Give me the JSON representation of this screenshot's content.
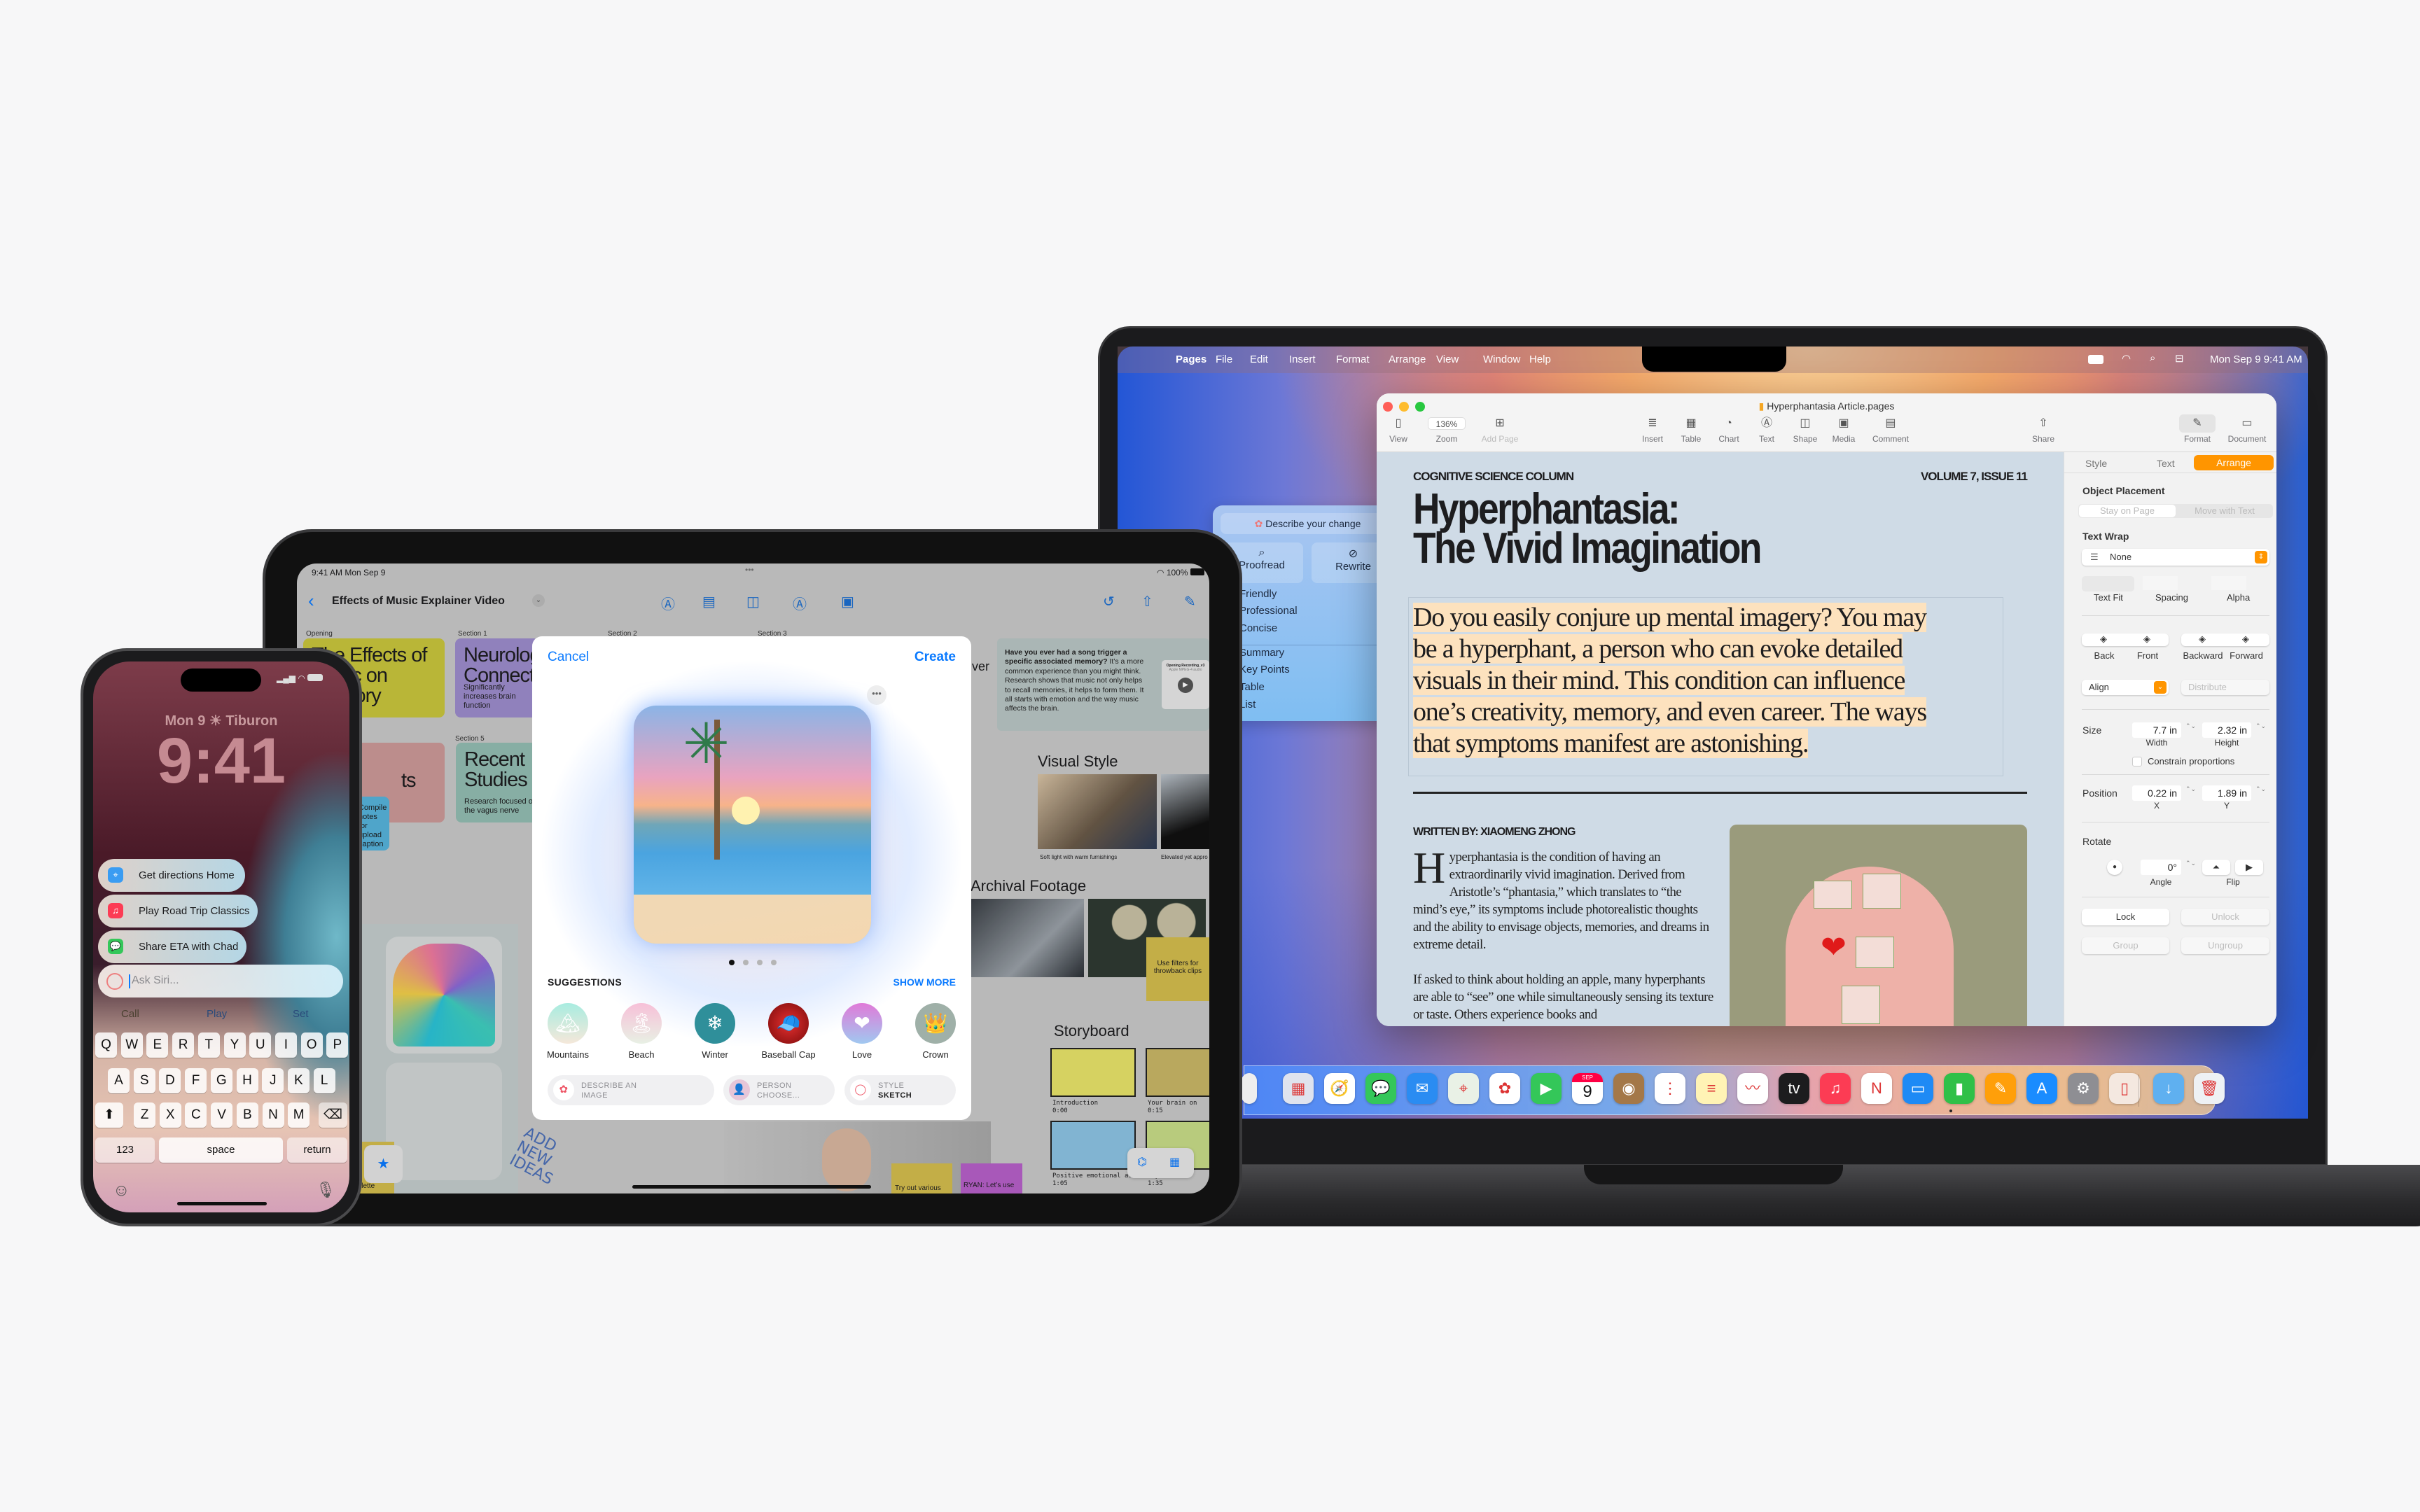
{
  "colors": {
    "accent_orange": "#ff9500",
    "ios_blue": "#0a7aff",
    "highlight": "#fde2be",
    "doc_bg": "#cfdbe6"
  },
  "mac": {
    "menubar": {
      "apple": "",
      "items": [
        "Pages",
        "File",
        "Edit",
        "Insert",
        "Format",
        "Arrange",
        "View",
        "Window",
        "Help"
      ],
      "status_icons": [
        "battery-icon",
        "wifi-icon",
        "search-icon",
        "control-center-icon"
      ],
      "datetime": "Mon Sep 9  9:41 AM"
    },
    "window": {
      "title": "Hyperphantasia Article.pages",
      "toolbar": [
        {
          "label": "View",
          "icon": "sidebar-icon"
        },
        {
          "label": "Zoom",
          "value": "136%"
        },
        {
          "label": "Add Page",
          "icon": "add-page-icon",
          "disabled": true
        },
        {
          "label": "Insert",
          "icon": "insert-icon"
        },
        {
          "label": "Table",
          "icon": "table-icon"
        },
        {
          "label": "Chart",
          "icon": "chart-icon"
        },
        {
          "label": "Text",
          "icon": "text-icon"
        },
        {
          "label": "Shape",
          "icon": "shape-icon"
        },
        {
          "label": "Media",
          "icon": "media-icon"
        },
        {
          "label": "Comment",
          "icon": "comment-icon"
        },
        {
          "label": "Share",
          "icon": "share-icon"
        },
        {
          "label": "Format",
          "icon": "format-brush-icon",
          "active": true
        },
        {
          "label": "Document",
          "icon": "document-icon"
        }
      ],
      "document": {
        "kicker": "COGNITIVE SCIENCE COLUMN",
        "issue": "VOLUME 7, ISSUE 11",
        "title_lines": [
          "Hyperphantasia:",
          "The Vivid Imagination"
        ],
        "intro_lines": [
          "Do you easily conjure up mental imagery? You may",
          "be a hyperphant, a person who can evoke detailed",
          "visuals in their mind. This condition can influence",
          "one’s creativity, memory, and even career. The ways",
          "that symptoms manifest are astonishing."
        ],
        "byline": "WRITTEN BY: XIAOMENG ZHONG",
        "drop_cap": "H",
        "body": [
          "yperphantasia is the condition of having an extraordinarily vivid imagination. Derived from Aristotle’s “phantasia,” which translates to “the mind’s eye,” its symptoms include photorealistic thoughts and the ability to envisage objects, memories, and dreams in extreme detail.",
          "If asked to think about holding an apple, many hyperphants are able to “see” one while simultaneously sensing its texture or taste. Others experience books and"
        ]
      },
      "inspector": {
        "tabs": [
          "Style",
          "Text",
          "Arrange"
        ],
        "active_tab": "Arrange",
        "object_placement": {
          "label": "Object Placement",
          "options": [
            "Stay on Page",
            "Move with Text"
          ]
        },
        "text_wrap": {
          "label": "Text Wrap",
          "value": "None"
        },
        "text_fit": "Text Fit",
        "spacing": "Spacing",
        "alpha": "Alpha",
        "arrange_buttons": [
          "Back",
          "Front",
          "Backward",
          "Forward"
        ],
        "align": "Align",
        "distribute": "Distribute",
        "size": {
          "label": "Size",
          "width": "7.7 in",
          "height": "2.32 in",
          "width_label": "Width",
          "height_label": "Height",
          "constrain": "Constrain proportions",
          "constrain_checked": false
        },
        "position": {
          "label": "Position",
          "x": "0.22 in",
          "y": "1.89 in",
          "x_label": "X",
          "y_label": "Y"
        },
        "rotate": {
          "label": "Rotate",
          "angle": "0°",
          "angle_label": "Angle",
          "flip_label": "Flip"
        },
        "lock": "Lock",
        "unlock": "Unlock",
        "group": "Group",
        "ungroup": "Ungroup"
      }
    },
    "writing_tools": {
      "prompt": "Describe your change",
      "actions": [
        "Proofread",
        "Rewrite"
      ],
      "tones": [
        "Friendly",
        "Professional",
        "Concise"
      ],
      "formats": [
        "Summary",
        "Key Points",
        "Table",
        "List"
      ]
    },
    "dock": [
      "partial",
      "launchpad",
      "safari",
      "messages",
      "mail",
      "maps",
      "photos",
      "facetime",
      "calendar",
      "contacts",
      "reminders",
      "notes",
      "freeform",
      "tv",
      "music",
      "news",
      "keynote",
      "numbers",
      "pages",
      "app-store",
      "settings",
      "iphone-mirroring",
      "downloads",
      "trash"
    ],
    "dock_calendar": {
      "month": "SEP",
      "day": "9"
    },
    "dock_tv": "tv"
  },
  "ipad": {
    "status": {
      "time": "9:41 AM  Mon Sep 9",
      "battery": "100%"
    },
    "title": "Effects of Music Explainer Video",
    "sections": [
      "Opening",
      "Section 1",
      "Section 2",
      "Section 3",
      "Section 5"
    ],
    "cards": {
      "opening": "The Effects of Music on Memory",
      "section1": "Neurological Connections",
      "section1_sub": "Significantly increases brain function",
      "section5": "Recent Studies",
      "section5_sub": "Research focused on the vagus nerve",
      "pink_partial": "ts",
      "blue_sticky": "Compile notes for upload caption"
    },
    "note": {
      "bold": "Have you ever had a song trigger a specific associated memory?",
      "text": " It’s a more common experience than you might think. Research shows that music not only helps to recall memories, it helps to form them. It all starts with emotion and the way music affects the brain.",
      "audio_title": "Opening Recording_v3",
      "audio_sub": "Apple MPEG-4 audio"
    },
    "partial_heading": "ver",
    "visual_style": {
      "heading": "Visual Style",
      "captions": [
        "Soft light with warm furnishings",
        "Elevated yet appro"
      ]
    },
    "archival": {
      "heading": "Archival Footage",
      "sticky": "Use filters for throwback clips"
    },
    "storyboard": {
      "heading": "Storyboard",
      "frames": [
        {
          "caption": "Introduction",
          "time": "0:00"
        },
        {
          "caption": "Your brain on",
          "time": "0:15"
        },
        {
          "caption": "Positive emotional associ",
          "time": "1:05"
        },
        {
          "caption": "imp",
          "time": "1:35"
        }
      ]
    },
    "handwriting": "ADD NEW IDEAS",
    "stickies": {
      "yellow_left": "Palette",
      "try": "Try out various",
      "ryan": "RYAN: Let’s use"
    },
    "image_playground": {
      "cancel": "Cancel",
      "create": "Create",
      "page_count": 4,
      "page_index": 1,
      "suggestions_label": "SUGGESTIONS",
      "show_more": "SHOW MORE",
      "suggestions": [
        {
          "label": "Mountains",
          "icon": "🏔"
        },
        {
          "label": "Beach",
          "icon": "🏝"
        },
        {
          "label": "Winter",
          "icon": "❄"
        },
        {
          "label": "Baseball Cap",
          "icon": "🧢"
        },
        {
          "label": "Love",
          "icon": "❤"
        },
        {
          "label": "Crown",
          "icon": "👑"
        }
      ],
      "pills": [
        {
          "top": "DESCRIBE AN",
          "bottom": "IMAGE"
        },
        {
          "top": "PERSON",
          "bottom": "CHOOSE..."
        },
        {
          "top": "STYLE",
          "bottom": "SKETCH"
        }
      ]
    }
  },
  "iphone": {
    "date_weather": "Mon 9  ☀  Tiburon",
    "time": "9:41",
    "suggestions": [
      {
        "label": "Get directions Home",
        "icon": "maps-icon"
      },
      {
        "label": "Play Road Trip Classics",
        "icon": "music-icon"
      },
      {
        "label": "Share ETA with Chad",
        "icon": "messages-icon"
      }
    ],
    "siri_placeholder": "Ask Siri...",
    "predictive": [
      "Call",
      "Play",
      "Set"
    ],
    "keys": [
      [
        "Q",
        "W",
        "E",
        "R",
        "T",
        "Y",
        "U",
        "I",
        "O",
        "P"
      ],
      [
        "A",
        "S",
        "D",
        "F",
        "G",
        "H",
        "J",
        "K",
        "L"
      ],
      [
        "Z",
        "X",
        "C",
        "V",
        "B",
        "N",
        "M"
      ]
    ],
    "key_123": "123",
    "key_space": "space",
    "key_return": "return"
  }
}
